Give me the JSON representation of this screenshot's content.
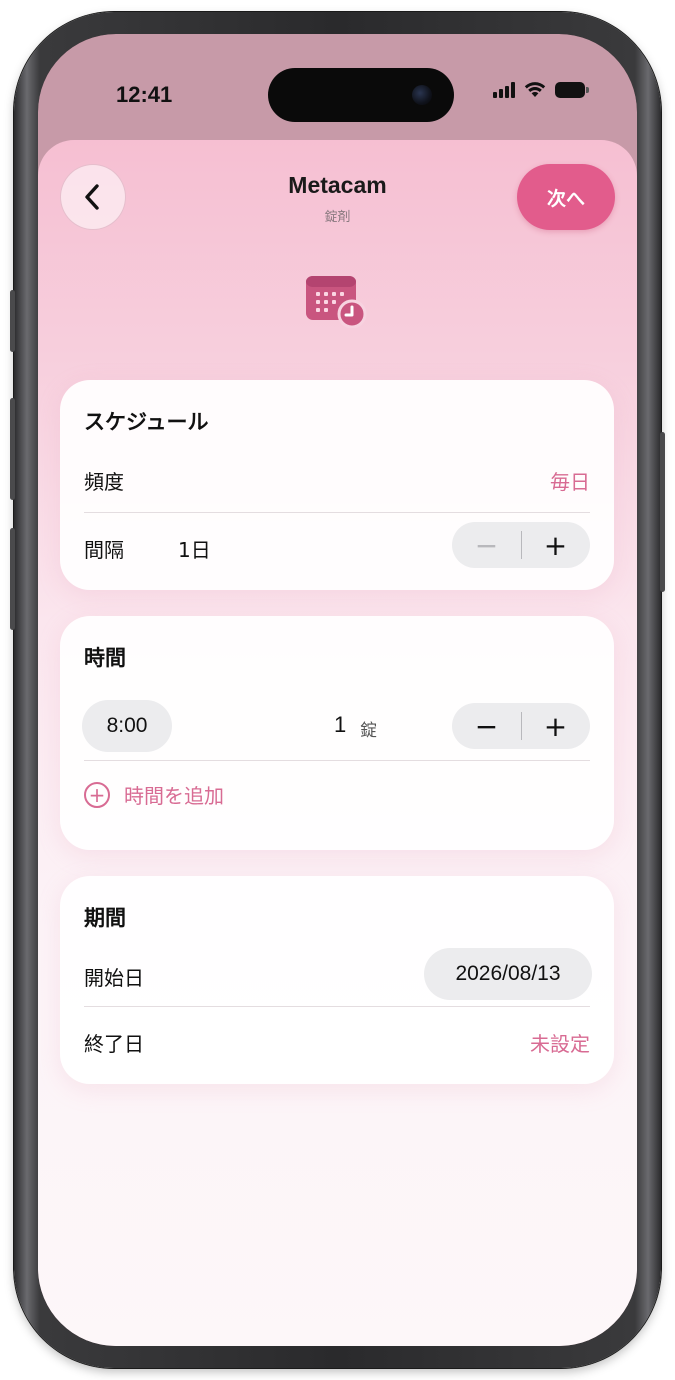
{
  "status_bar": {
    "time": "12:41"
  },
  "nav": {
    "title": "Metacam",
    "subtitle": "錠剤",
    "next_label": "次へ"
  },
  "icons": {
    "back": "chevron-left-icon",
    "hero": "calendar-clock-icon",
    "add": "plus-circle-icon"
  },
  "schedule": {
    "title": "スケジュール",
    "frequency_label": "頻度",
    "frequency_value": "毎日",
    "interval_label": "間隔",
    "interval_value": "1日",
    "minus": "−",
    "plus": "+"
  },
  "time_section": {
    "title": "時間",
    "time_value": "8:00",
    "dose_count": "1",
    "dose_unit": "錠",
    "minus": "−",
    "plus": "+",
    "add_time_label": "時間を追加"
  },
  "period": {
    "title": "期間",
    "start_label": "開始日",
    "start_value": "2026/08/13",
    "end_label": "終了日",
    "end_value": "未設定"
  },
  "colors": {
    "accent": "#e25c8c",
    "accent_text": "#d86b93",
    "hero_icon": "#c9557f"
  }
}
